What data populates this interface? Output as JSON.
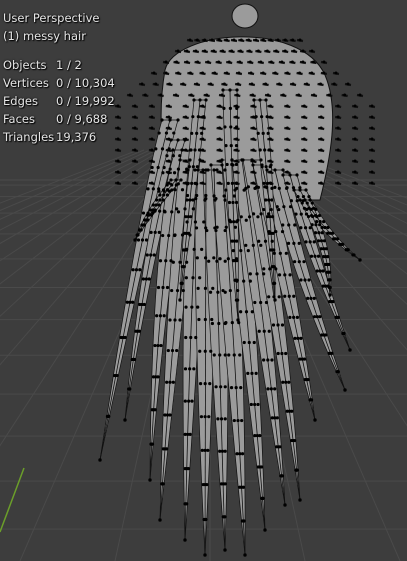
{
  "viewport": {
    "view_name": "User Perspective",
    "object_label": "(1) messy hair",
    "background_color": "#3d3d3d",
    "grid_color": "#4a4a4a",
    "axis_color": "#6b9e2a",
    "mesh_fill_color": "#9b9b9b",
    "wire_color": "#111111",
    "vertex_color": "#000000"
  },
  "stats": [
    {
      "label": "Objects",
      "value": "1 / 2"
    },
    {
      "label": "Vertices",
      "value": "0 / 10,304"
    },
    {
      "label": "Edges",
      "value": "0 / 19,992"
    },
    {
      "label": "Faces",
      "value": "0 / 9,688"
    },
    {
      "label": "Triangles",
      "value": "19,376"
    }
  ]
}
